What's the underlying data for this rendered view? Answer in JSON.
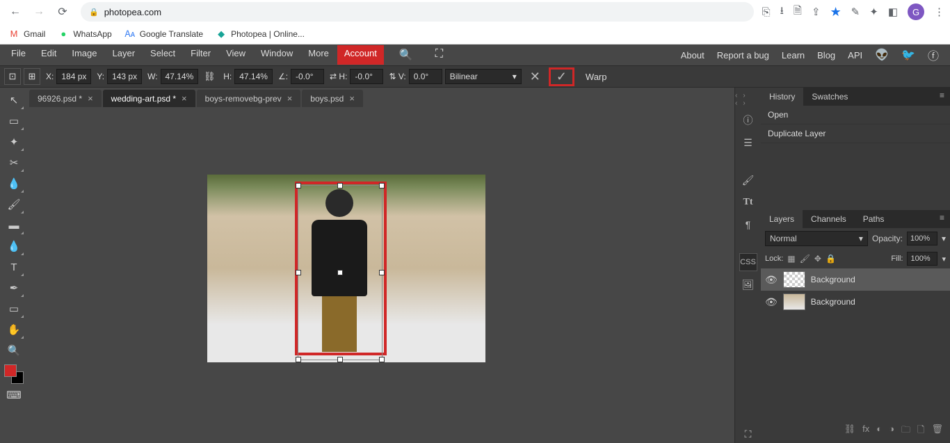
{
  "browser": {
    "url": "photopea.com",
    "profile_letter": "G",
    "bookmarks": [
      {
        "icon": "✉",
        "label": "Gmail",
        "color": "#ea4335"
      },
      {
        "icon": "●",
        "label": "WhatsApp",
        "color": "#25d366"
      },
      {
        "icon": "G",
        "label": "Google Translate",
        "color": "#4285f4"
      },
      {
        "icon": "◆",
        "label": "Photopea | Online...",
        "color": "#18a497"
      }
    ]
  },
  "menu": {
    "items": [
      "File",
      "Edit",
      "Image",
      "Layer",
      "Select",
      "Filter",
      "View",
      "Window",
      "More"
    ],
    "account": "Account",
    "right": [
      "About",
      "Report a bug",
      "Learn",
      "Blog",
      "API"
    ]
  },
  "options": {
    "x_label": "X:",
    "x_val": "184 px",
    "y_label": "Y:",
    "y_val": "143 px",
    "w_label": "W:",
    "w_val": "47.14%",
    "h_label": "H:",
    "h_val": "47.14%",
    "ang_label": "∠:",
    "ang_val": "-0.0°",
    "sh_label": "⇄ H:",
    "sh_val": "-0.0°",
    "sv_label": "⇅ V:",
    "sv_val": "0.0°",
    "interp": "Bilinear",
    "warp": "Warp"
  },
  "tabs": [
    {
      "label": "96926.psd *",
      "active": false
    },
    {
      "label": "wedding-art.psd *",
      "active": true
    },
    {
      "label": "boys-removebg-prev",
      "active": false
    },
    {
      "label": "boys.psd",
      "active": false
    }
  ],
  "history": {
    "tabs": [
      "History",
      "Swatches"
    ],
    "items": [
      "Open",
      "Duplicate Layer"
    ]
  },
  "layers_panel": {
    "tabs": [
      "Layers",
      "Channels",
      "Paths"
    ],
    "blend": "Normal",
    "opacity_label": "Opacity:",
    "opacity": "100%",
    "lock_label": "Lock:",
    "fill_label": "Fill:",
    "fill": "100%",
    "layers": [
      {
        "name": "Background",
        "sel": true,
        "thumb": "checker"
      },
      {
        "name": "Background",
        "sel": false,
        "thumb": "img"
      }
    ]
  }
}
